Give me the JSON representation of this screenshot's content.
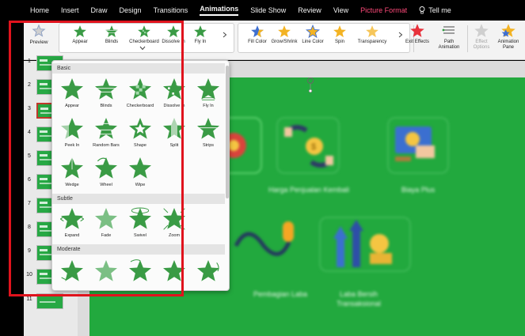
{
  "menubar": {
    "tabs": [
      "Home",
      "Insert",
      "Draw",
      "Design",
      "Transitions",
      "Animations",
      "Slide Show",
      "Review",
      "View",
      "Picture Format"
    ],
    "active_tab": "Animations",
    "tell_me": "Tell me"
  },
  "ribbon": {
    "preview": "Preview",
    "gallery_top": [
      "Appear",
      "Blinds",
      "Checkerboard",
      "Dissolve In",
      "Fly In"
    ],
    "emphasis": [
      "Fill Color",
      "Grow/Shrink",
      "Line Color",
      "Spin",
      "Transparency"
    ],
    "exit_effects": "Exit Effects",
    "path_animation": "Path Animation",
    "effect_options": "Effect Options",
    "animation_pane": "Animation Pane"
  },
  "gallery": {
    "sections": {
      "basic": "Basic",
      "subtle": "Subtle",
      "moderate": "Moderate"
    },
    "basic_items": [
      "Appear",
      "Blinds",
      "Checkerboard",
      "Dissolve In",
      "Fly In",
      "Peek In",
      "Random Bars",
      "Shape",
      "Split",
      "Strips",
      "Wedge",
      "Wheel",
      "Wipe"
    ],
    "subtle_items": [
      "Expand",
      "Fade",
      "Swivel",
      "Zoom"
    ]
  },
  "slides": {
    "numbers": [
      "1",
      "2",
      "3",
      "4",
      "5",
      "6",
      "7",
      "8",
      "9",
      "10",
      "11"
    ],
    "selected": 3
  },
  "slide_content": {
    "captions": [
      "Harga Penjualan Kembali",
      "Biaya Plus",
      "Pembagian Laba",
      "Laba Bersih Transaksional"
    ],
    "partial_caption": "an"
  },
  "colors": {
    "accent_green": "#3a9b45",
    "highlight_red": "#e0131d",
    "slide_bg": "#22a93e",
    "picture_format": "#ff4a7a"
  }
}
